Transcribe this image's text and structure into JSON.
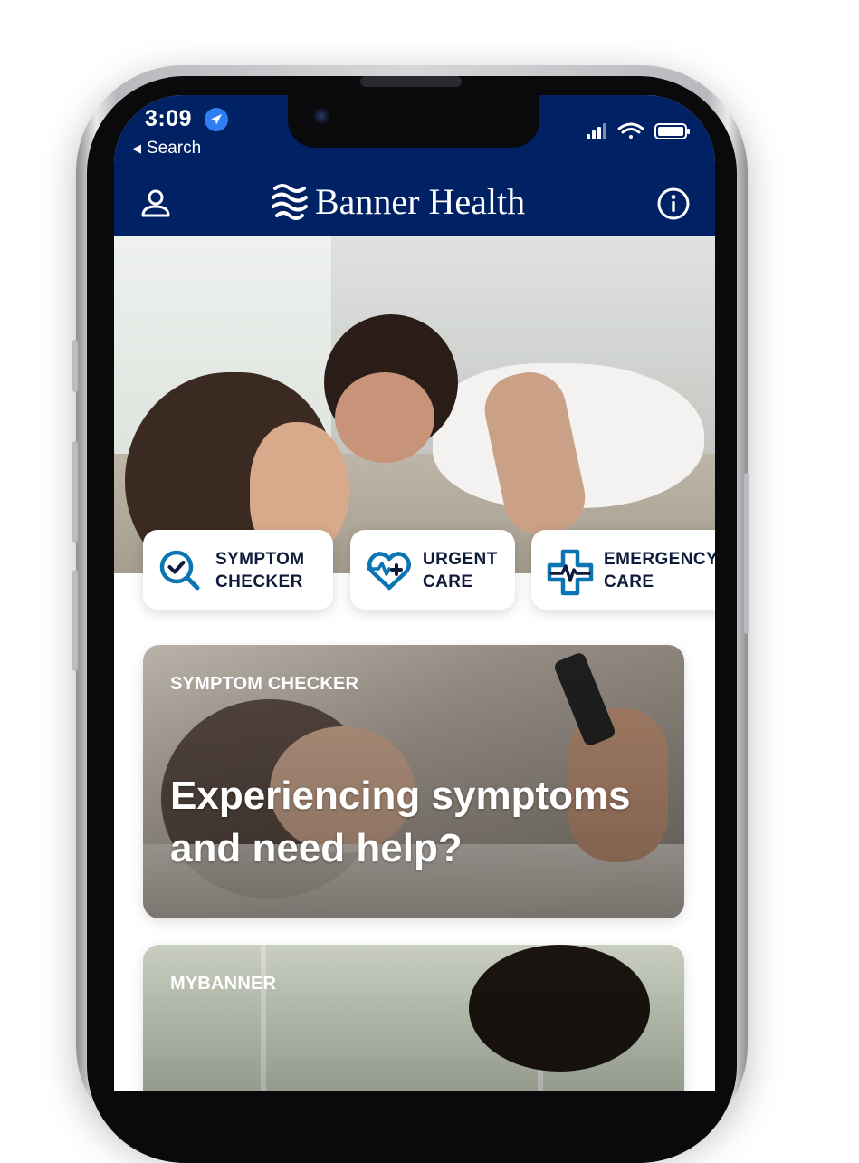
{
  "status_bar": {
    "time": "3:09",
    "back_label": "Search",
    "icons": [
      "location-arrow-icon",
      "signal-icon",
      "wifi-icon",
      "battery-icon"
    ]
  },
  "header": {
    "brand": "Banner Health",
    "profile_icon": "person-icon",
    "info_icon": "info-icon",
    "colors": {
      "navy": "#002163",
      "accent": "#0b74b3"
    }
  },
  "quick_actions": [
    {
      "line1": "SYMPTOM",
      "line2": "CHECKER",
      "icon": "magnifier-check-icon"
    },
    {
      "line1": "URGENT",
      "line2": "CARE",
      "icon": "heart-plus-icon"
    },
    {
      "line1": "EMERGENCY",
      "line2": "CARE",
      "icon": "medical-cross-pulse-icon"
    }
  ],
  "cards": [
    {
      "eyebrow": "SYMPTOM CHECKER",
      "title": "Experiencing symptoms and need help?"
    },
    {
      "eyebrow": "MYBANNER",
      "title": ""
    }
  ]
}
